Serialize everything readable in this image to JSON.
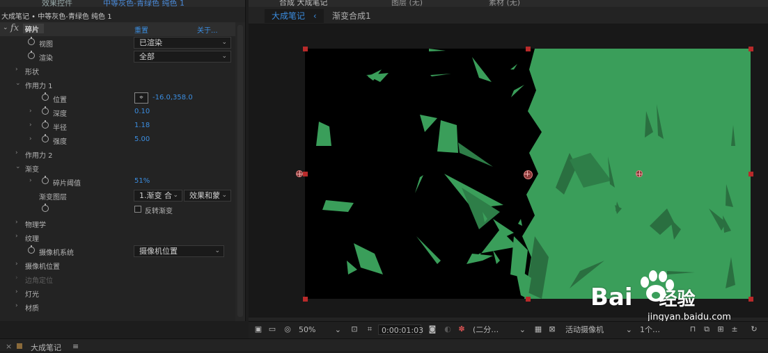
{
  "effects_panel": {
    "header_tab_text": "效果控件",
    "header_tab_layer": "中等灰色-青绿色 纯色 1",
    "subheader": "大成笔记 • 中等灰色-青绿色 纯色 1",
    "fx_label": "fx",
    "effect_name": "碎片",
    "reset_label": "重置",
    "about_label": "关于...",
    "rows": {
      "view_label": "视图",
      "view_value": "已渲染",
      "render_label": "渲染",
      "render_value": "全部",
      "shape_label": "形状",
      "force1_label": "作用力 1",
      "position_label": "位置",
      "position_value": "-16.0,358.0",
      "depth_label": "深度",
      "depth_value": "0.10",
      "radius_label": "半径",
      "radius_value": "1.18",
      "strength_label": "强度",
      "strength_value": "5.00",
      "force2_label": "作用力 2",
      "gradient_label": "渐变",
      "threshold_label": "碎片阈值",
      "threshold_value": "51%",
      "gradient_layer_label": "渐变图层",
      "gradient_layer_value": "1.渐变 合",
      "gradient_layer_mode": "效果和蒙",
      "invert_label": "反转渐变",
      "physics_label": "物理学",
      "texture_label": "纹理",
      "camera_system_label": "摄像机系统",
      "camera_system_value": "摄像机位置",
      "camera_position_label": "摄像机位置",
      "corner_pin_label": "边角定位",
      "lights_label": "灯光",
      "material_label": "材质"
    }
  },
  "viewer": {
    "tab_comp": "合成 大成笔记",
    "tab_layer": "图层 (无)",
    "tab_footage": "素材 (无)",
    "breadcrumb_active": "大成笔记",
    "breadcrumb_arrow": "‹",
    "breadcrumb_other": "渐变合成1",
    "zoom_value": "50%",
    "timecode": "0:00:01:03",
    "resolution_value": "(二分…",
    "camera_value": "活动摄像机",
    "view_count": "1个…"
  },
  "bottom_bar": {
    "timeline_tab": "大成笔记",
    "menu_icon": "≡"
  },
  "watermark": {
    "brand": "Bai",
    "brand_cn": "经验",
    "url": "jingyan.baidu.com"
  },
  "colors": {
    "accent_blue": "#3b8de0",
    "shard_green": "#3a9e5a",
    "handle_red": "#b82a2a"
  }
}
